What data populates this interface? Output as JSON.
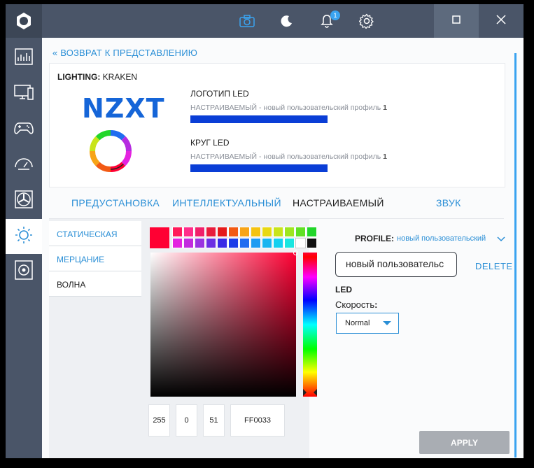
{
  "titlebar": {
    "notification_count": "1",
    "icons": [
      "logo-icon",
      "camera-icon",
      "moon-icon",
      "bell-icon",
      "gear-icon",
      "minimize-icon",
      "maximize-icon",
      "close-icon"
    ]
  },
  "sidebar": {
    "items": [
      {
        "icon": "dashboard-icon"
      },
      {
        "icon": "pc-icon"
      },
      {
        "icon": "gamepad-icon"
      },
      {
        "icon": "speedometer-icon"
      },
      {
        "icon": "fan-icon"
      },
      {
        "icon": "lighting-icon",
        "active": true
      },
      {
        "icon": "audio-icon"
      }
    ]
  },
  "back_link": "ВОЗВРАТ К ПРЕДСТАВЛЕНИЮ",
  "device": {
    "title_prefix": "LIGHTING:",
    "title_name": "KRAKEN",
    "logo_text": "NZXT",
    "leds": [
      {
        "name": "ЛОГОТИП LED",
        "profile_prefix": "НАСТРАИВАЕМЫЙ - новый пользовательский профиль ",
        "profile_num": "1"
      },
      {
        "name": "КРУГ LED",
        "profile_prefix": "НАСТРАИВАЕМЫЙ - новый пользовательский профиль ",
        "profile_num": "1"
      }
    ]
  },
  "tabs": [
    {
      "label": "ПРЕДУСТАНОВКА",
      "active": false
    },
    {
      "label": "ИНТЕЛЛЕКТУАЛЬНЫЙ",
      "active": false
    },
    {
      "label": "НАСТРАИВАЕМЫЙ",
      "active": true
    },
    {
      "label": "ЗВУК",
      "active": false
    }
  ],
  "modes": [
    {
      "label": "СТАТИЧЕСКАЯ",
      "active": false
    },
    {
      "label": "МЕРЦАНИЕ",
      "active": false
    },
    {
      "label": "ВОЛНА",
      "active": true
    }
  ],
  "color": {
    "selected_hex_color": "#ff0033",
    "r": "255",
    "g": "0",
    "b": "51",
    "hex": "FF0033",
    "swatches_row1": [
      "#ff1a5a",
      "#ff2d8a",
      "#f0206a",
      "#e81c3c",
      "#e51a1a",
      "#f25a14",
      "#f7a417",
      "#f5c311",
      "#e8d812",
      "#c8e41a",
      "#9ee61f",
      "#5fe024",
      "#22d62a"
    ],
    "swatches_row2": [
      "#e423e0",
      "#c22bde",
      "#9a34e0",
      "#6b2fe3",
      "#3a2ae6",
      "#1d3ee8",
      "#1f6cf0",
      "#1f9cf2",
      "#18b5f0",
      "#14d0f0",
      "#19e6e0",
      "#ffffff",
      "#111111"
    ]
  },
  "right_panel": {
    "profile_label": "PROFILE:",
    "profile_value": "новый пользовательский",
    "profile_name_input": "новый пользовательс",
    "delete_label": "DELETE",
    "led_label": "LED",
    "speed_label": "Скорость",
    "speed_colon": ":",
    "speed_value": "Normal",
    "apply_label": "APPLY"
  }
}
